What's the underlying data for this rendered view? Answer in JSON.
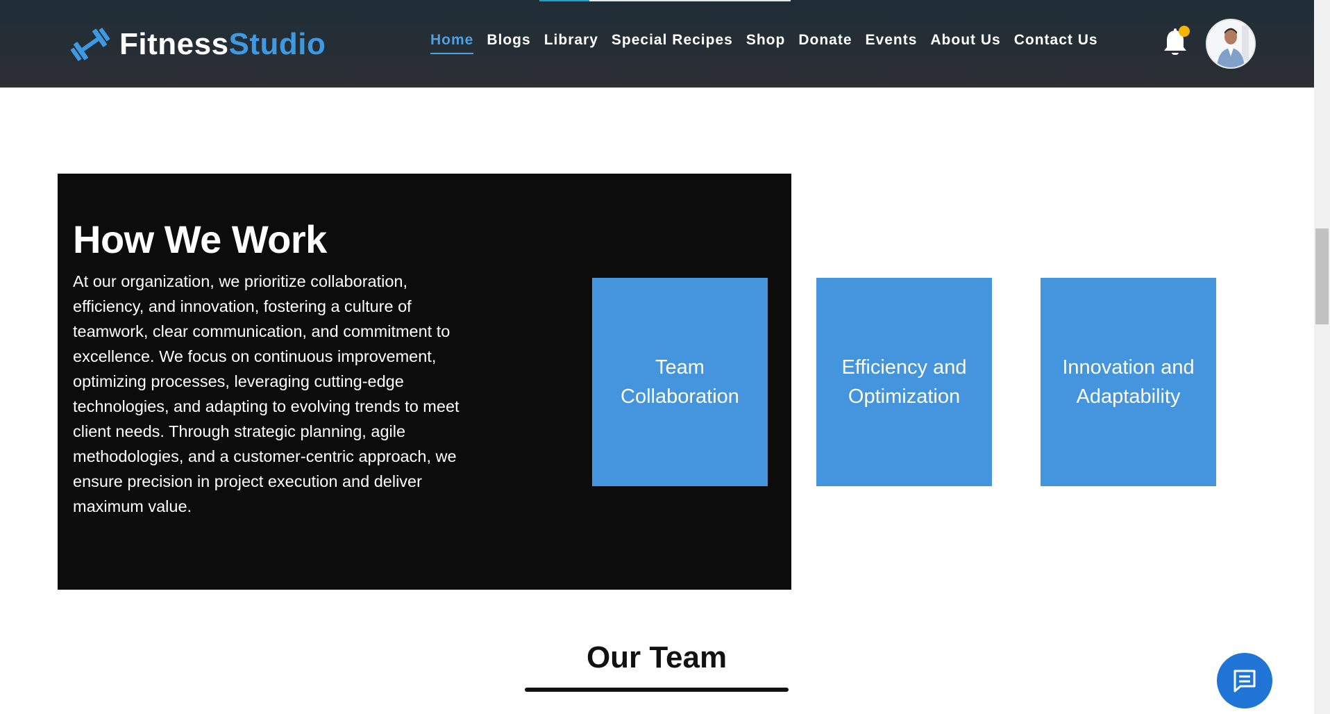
{
  "brand": {
    "name_part1": "Fitness",
    "name_part2": "Studio",
    "logo_icon": "dumbbell-icon",
    "colors": {
      "accent": "#3d9ae2",
      "header_bg": "#2c2f33"
    }
  },
  "nav": {
    "items": [
      {
        "label": "Home",
        "active": true
      },
      {
        "label": "Blogs"
      },
      {
        "label": "Library"
      },
      {
        "label": "Special Recipes"
      },
      {
        "label": "Shop"
      },
      {
        "label": "Donate"
      },
      {
        "label": "Events"
      },
      {
        "label": "About Us"
      },
      {
        "label": "Contact Us"
      }
    ]
  },
  "header": {
    "notification_icon": "bell-icon",
    "notification_badge_color": "#f4b400",
    "avatar_icon": "user-avatar"
  },
  "how_we_work": {
    "title": "How We Work",
    "description": "At our organization, we prioritize collaboration, efficiency, and innovation, fostering a culture of teamwork, clear communication, and commitment to excellence. We focus on continuous improvement, optimizing processes, leveraging cutting-edge technologies, and adapting to evolving trends to meet client needs. Through strategic planning, agile methodologies, and a customer-centric approach, we ensure precision in project execution and deliver maximum value.",
    "cards": [
      {
        "label": "Team Collaboration"
      },
      {
        "label": "Efficiency and Optimization"
      },
      {
        "label": "Innovation and Adaptability"
      }
    ],
    "card_color": "#4494de"
  },
  "team": {
    "title": "Our Team"
  },
  "chat": {
    "icon": "chat-bubble-icon",
    "color": "#1f74d6"
  }
}
